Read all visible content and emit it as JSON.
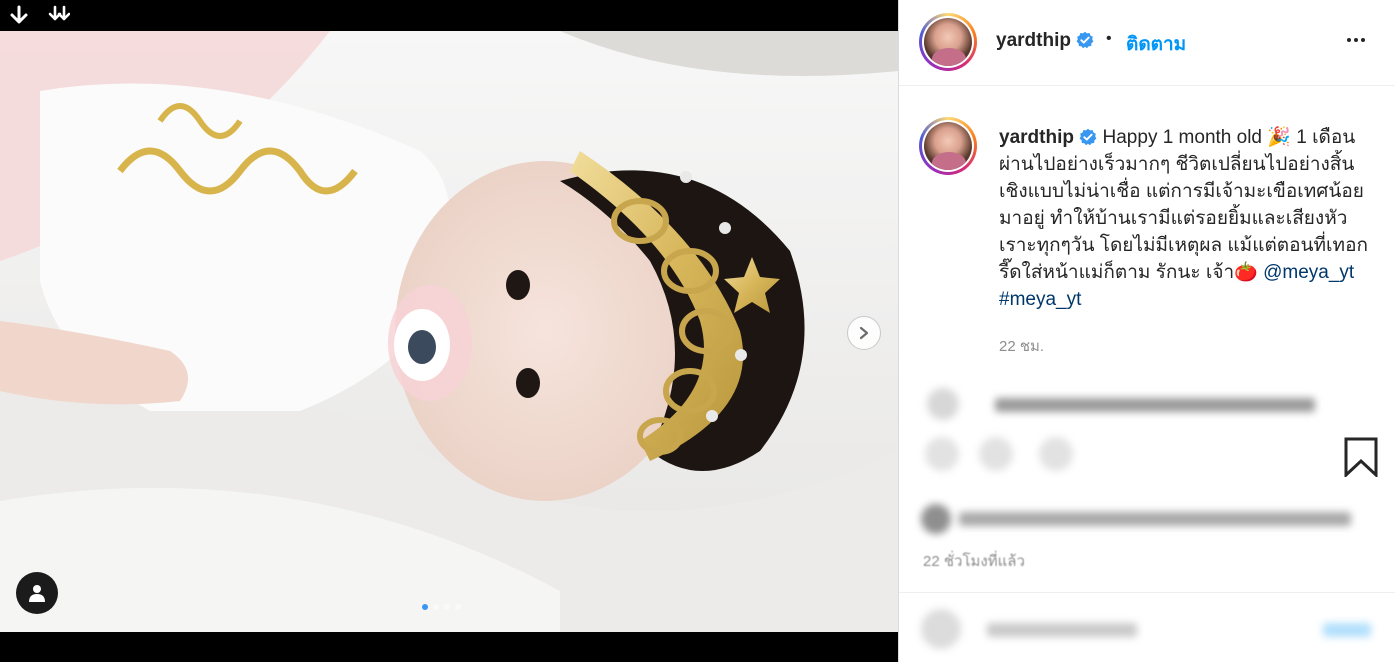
{
  "media": {
    "carousel": {
      "total": 4,
      "active_index": 0
    }
  },
  "header": {
    "username": "yardthip",
    "separator": "•",
    "follow_label": "ติดตาม"
  },
  "caption": {
    "username": "yardthip",
    "text": "Happy 1 month old 🎉 1 เดือน ผ่านไปอย่างเร็วมากๆ ชีวิตเปลี่ยนไปอย่างสิ้นเชิงแบบไม่น่าเชื่อ แต่การมีเจ้ามะเขือเทศน้อยมาอยู่ ทำให้บ้านเรามีแต่รอยยิ้มและเสียงหัวเราะทุกๆวัน โดยไม่มีเหตุผล แม้แต่ตอนที่เทอกรี๊ดใส่หน้าแม่ก็ตาม รักนะ เจ้า🍅",
    "mention": "@meya_yt",
    "hashtag": "#meya_yt",
    "time": "22 ชม."
  },
  "post_meta": {
    "time_ago": "22 ชั่วโมงที่แล้ว"
  },
  "colors": {
    "accent": "#0095f6",
    "hashtag": "#00376b",
    "muted": "#8e8e8e",
    "text": "#262626"
  },
  "icons": {
    "download": "download-icon",
    "download_all": "download-all-icon",
    "next": "chevron-right-icon",
    "user_tag": "user-tag-icon",
    "verified": "verified-badge-icon",
    "more": "more-options-icon",
    "bookmark": "bookmark-icon"
  }
}
